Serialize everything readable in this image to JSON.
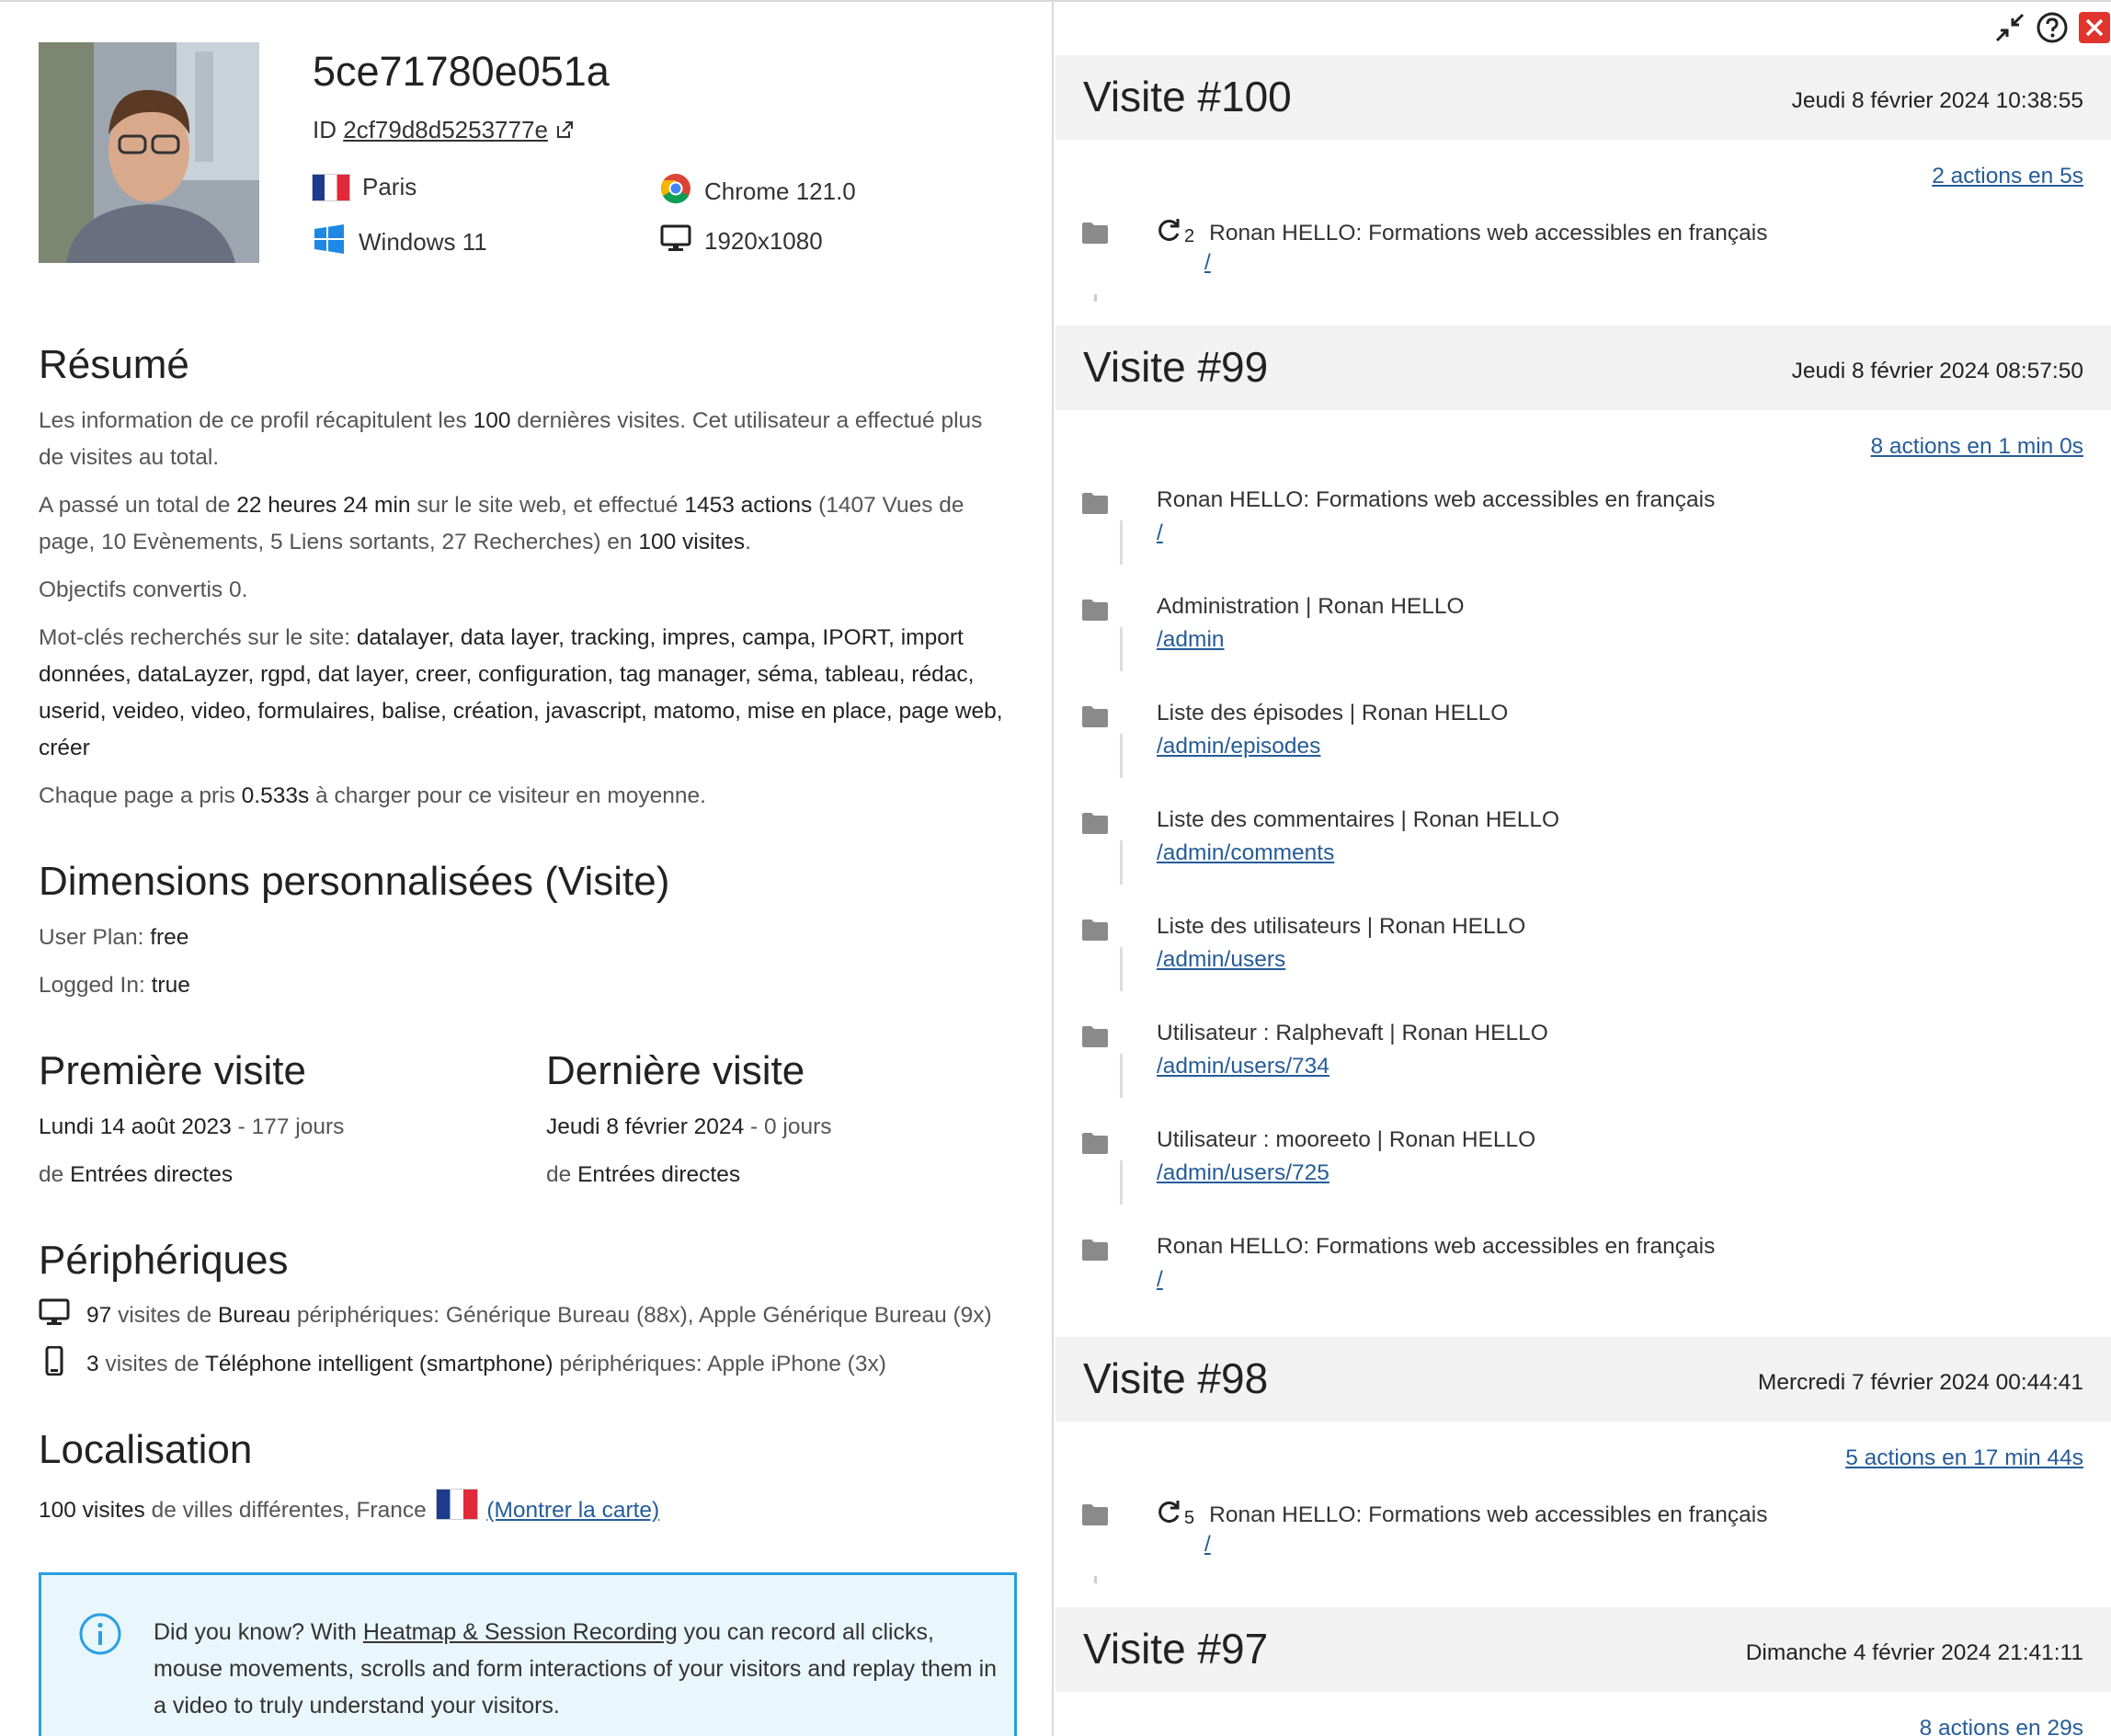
{
  "profile": {
    "visitor_id": "5ce71780e051a",
    "id_label": "ID",
    "id_value": "2cf79d8d5253777e",
    "city": "Paris",
    "os": "Windows 11",
    "browser": "Chrome 121.0",
    "resolution": "1920x1080"
  },
  "summary": {
    "heading": "Résumé",
    "p1_a": "Les information de ce profil récapitulent les ",
    "p1_b": "100",
    "p1_c": " dernières visites. Cet utilisateur a effectué plus de visites au total.",
    "p2_a": "A passé un total de ",
    "p2_b": "22 heures 24 min",
    "p2_c": " sur le site web, et effectué ",
    "p2_d": "1453 actions",
    "p2_e": " (1407 Vues de page, 10 Evènements, 5 Liens sortants, 27 Recherches) en ",
    "p2_f": "100 visites",
    "p2_g": ".",
    "p3": "Objectifs convertis 0.",
    "p4_a": "Mot-clés recherchés sur le site: ",
    "p4_b": "datalayer, data layer, tracking, impres, campa, IPORT, import données, dataLayzer, rgpd, dat layer, creer, configuration, tag manager, séma, tableau, rédac, userid, veideo, video, formulaires, balise, création, javascript, matomo, mise en place, page web, créer",
    "p5_a": "Chaque page a pris ",
    "p5_b": "0.533s",
    "p5_c": " à charger pour ce visiteur en moyenne."
  },
  "dimensions": {
    "heading": "Dimensions personnalisées (Visite)",
    "plan_label": "User Plan: ",
    "plan_value": "free",
    "logged_label": "Logged In: ",
    "logged_value": "true"
  },
  "first_visit": {
    "heading": "Première visite",
    "date": "Lundi 14 août 2023",
    "ago": " - 177 jours",
    "from": "de ",
    "source": "Entrées directes"
  },
  "last_visit": {
    "heading": "Dernière visite",
    "date": "Jeudi 8 février 2024",
    "ago": " - 0 jours",
    "from": "de ",
    "source": "Entrées directes"
  },
  "devices": {
    "heading": "Périphériques",
    "d1_count": "97",
    "d1_a": " visites de ",
    "d1_type": "Bureau",
    "d1_b": " périphériques: Générique Bureau (88x), Apple Générique Bureau (9x)",
    "d2_count": "3",
    "d2_a": " visites de ",
    "d2_type": "Téléphone intelligent (smartphone)",
    "d2_b": " périphériques: Apple iPhone (3x)"
  },
  "location": {
    "heading": "Localisation",
    "count": "100 visites",
    "text": " de villes différentes, France",
    "map_link": "(Montrer la carte)"
  },
  "notice": {
    "a": "Did you know? With ",
    "link": "Heatmap & Session Recording",
    "b": " you can record all clicks, mouse movements, scrolls and form interactions of your visitors and replay them in a video to truly understand your visitors."
  },
  "visits": [
    {
      "title": "Visite #100",
      "date": "Jeudi 8 février 2024 10:38:55",
      "actions_summary": "2 actions en 5s",
      "actions": [
        {
          "repeat": "2",
          "title": "Ronan HELLO: Formations web accessibles en français",
          "url": "/"
        }
      ]
    },
    {
      "title": "Visite #99",
      "date": "Jeudi 8 février 2024 08:57:50",
      "actions_summary": "8 actions en 1 min 0s",
      "actions": [
        {
          "title": "Ronan HELLO: Formations web accessibles en français",
          "url": "/"
        },
        {
          "title": "Administration | Ronan HELLO",
          "url": "/admin"
        },
        {
          "title": "Liste des épisodes | Ronan HELLO",
          "url": "/admin/episodes"
        },
        {
          "title": "Liste des commentaires | Ronan HELLO",
          "url": "/admin/comments"
        },
        {
          "title": "Liste des utilisateurs | Ronan HELLO",
          "url": "/admin/users"
        },
        {
          "title": "Utilisateur : Ralphevaft | Ronan HELLO",
          "url": "/admin/users/734"
        },
        {
          "title": "Utilisateur : mooreeto | Ronan HELLO",
          "url": "/admin/users/725"
        },
        {
          "title": "Ronan HELLO: Formations web accessibles en français",
          "url": "/"
        }
      ]
    },
    {
      "title": "Visite #98",
      "date": "Mercredi 7 février 2024 00:44:41",
      "actions_summary": "5 actions en 17 min 44s",
      "actions": [
        {
          "repeat": "5",
          "title": "Ronan HELLO: Formations web accessibles en français",
          "url": "/"
        }
      ]
    },
    {
      "title": "Visite #97",
      "date": "Dimanche 4 février 2024 21:41:11",
      "actions_summary": "8 actions en 29s",
      "actions": []
    }
  ],
  "icons": {
    "minimize": "minimize-icon",
    "help": "help-icon",
    "close": "close-icon",
    "close_color": "#e0342c",
    "info_color": "#28a0e0"
  }
}
